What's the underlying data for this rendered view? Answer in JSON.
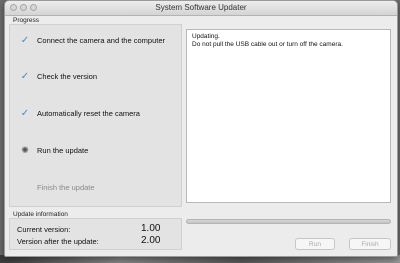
{
  "window": {
    "title": "System Software Updater"
  },
  "progress": {
    "label": "Progress",
    "steps": [
      {
        "label": "Connect the camera and the computer",
        "state": "done"
      },
      {
        "label": "Check the version",
        "state": "done"
      },
      {
        "label": "Automatically reset the camera",
        "state": "done"
      },
      {
        "label": "Run the update",
        "state": "in-progress"
      },
      {
        "label": "Finish the update",
        "state": "pending"
      }
    ]
  },
  "log": {
    "line1": "Updating.",
    "line2": "Do not pull the USB cable out or turn off the camera."
  },
  "update_info": {
    "label": "Update information",
    "current_label": "Current version:",
    "current_value": "1.00",
    "after_label": "Version after the update:",
    "after_value": "2.00"
  },
  "buttons": {
    "run": "Run",
    "finish": "Finish"
  },
  "colors": {
    "check": "#4a89c8",
    "panel": "#e3e3e3",
    "window": "#ececec"
  },
  "icons": {
    "done": "check-icon",
    "in_progress": "spinner-icon"
  }
}
